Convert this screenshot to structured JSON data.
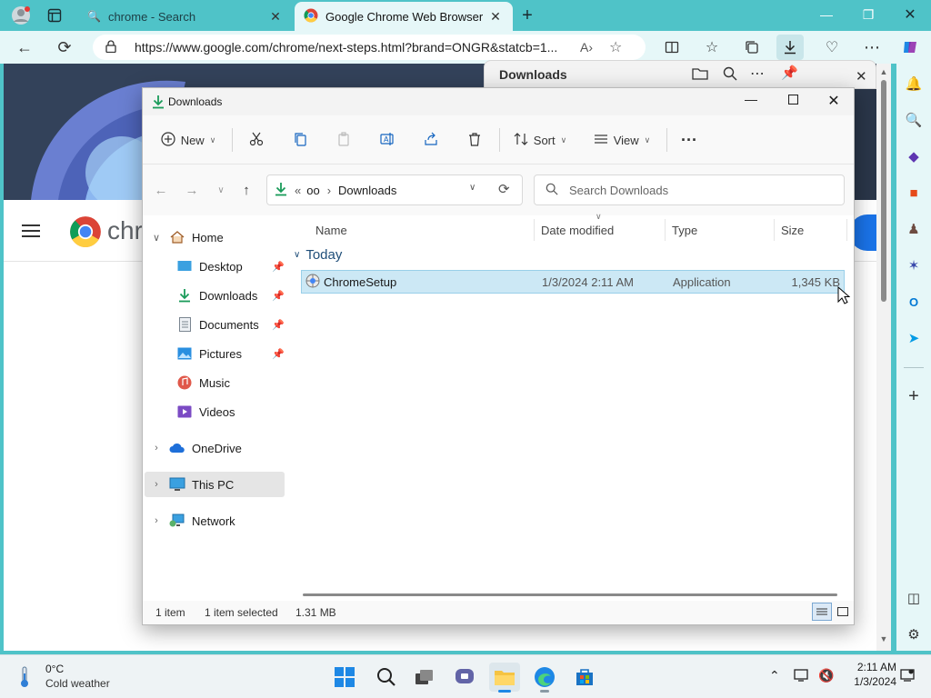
{
  "browser": {
    "tabs": [
      {
        "label": "chrome - Search",
        "close": "✕"
      },
      {
        "label": "Google Chrome Web Browser",
        "close": "✕"
      }
    ],
    "new_tab": "+",
    "url": "https://www.google.com/chrome/next-steps.html?brand=ONGR&statcb=1..."
  },
  "page": {
    "chrome_word": "chr"
  },
  "downloads_flyout": {
    "title": "Downloads"
  },
  "explorer": {
    "title": "Downloads",
    "toolbar": {
      "new_label": "New",
      "sort_label": "Sort",
      "view_label": "View",
      "more_label": "···"
    },
    "address": {
      "prefix": "«",
      "crumb1": "oo",
      "sep": "›",
      "crumb2": "Downloads"
    },
    "search_placeholder": "Search Downloads",
    "nav": {
      "home": "Home",
      "desktop": "Desktop",
      "downloads": "Downloads",
      "documents": "Documents",
      "pictures": "Pictures",
      "music": "Music",
      "videos": "Videos",
      "onedrive": "OneDrive",
      "thispc": "This PC",
      "network": "Network"
    },
    "columns": {
      "name": "Name",
      "date": "Date modified",
      "type": "Type",
      "size": "Size"
    },
    "group": "Today",
    "file": {
      "name": "ChromeSetup",
      "date": "1/3/2024 2:11 AM",
      "type": "Application",
      "size": "1,345 KB"
    },
    "status": {
      "count": "1 item",
      "selected": "1 item selected",
      "size": "1.31 MB"
    }
  },
  "taskbar": {
    "temp": "0°C",
    "weather": "Cold weather",
    "time": "2:11 AM",
    "date": "1/3/2024"
  },
  "colors": {
    "accent": "#4fc3c8",
    "selection": "#cce8f5"
  }
}
